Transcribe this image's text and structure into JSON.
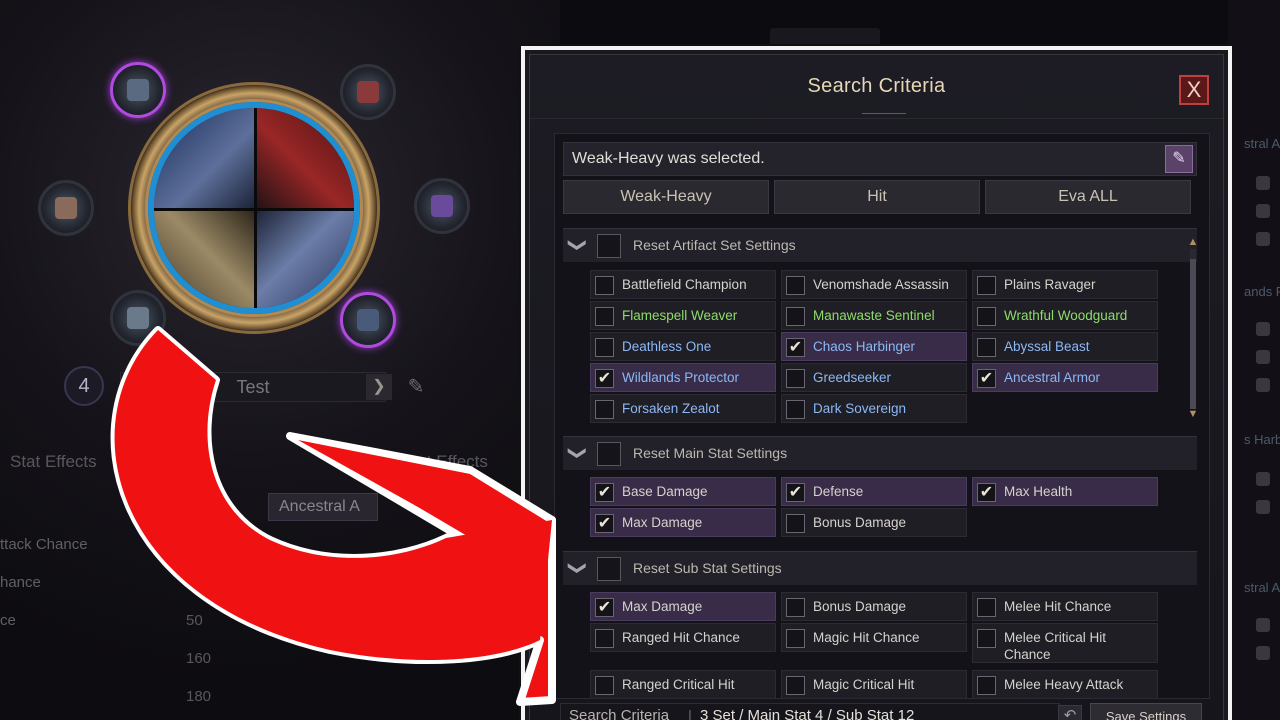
{
  "background": {
    "level": "4",
    "preset_name": "Test",
    "next_arrow": "❯",
    "edit_glyph": "✎",
    "tabs": [
      "Stat Effects",
      "Set Effects"
    ],
    "chip": "Ancestral A",
    "stats": [
      {
        "label": "ttack Chance",
        "value": ""
      },
      {
        "label": "hance",
        "value": ""
      },
      {
        "label": "ce",
        "value": "50"
      },
      {
        "label": "",
        "value": "160"
      },
      {
        "label": "",
        "value": "180"
      }
    ],
    "right_texts": [
      "stral A",
      "ands P",
      "s Harbi",
      "stral A"
    ]
  },
  "dialog": {
    "title": "Search Criteria",
    "close_label": "X",
    "selected_text": "Weak-Heavy was selected.",
    "edit_glyph": "✎",
    "presets": [
      "Weak-Heavy",
      "Hit",
      "Eva ALL"
    ],
    "sections": {
      "artifact": {
        "label": "Reset Artifact Set Settings",
        "options": [
          {
            "label": "Battlefield Champion",
            "checked": false,
            "color": "white"
          },
          {
            "label": "Venomshade Assassin",
            "checked": false,
            "color": "white"
          },
          {
            "label": "Plains Ravager",
            "checked": false,
            "color": "white"
          },
          {
            "label": "Flamespell Weaver",
            "checked": false,
            "color": "green"
          },
          {
            "label": "Manawaste Sentinel",
            "checked": false,
            "color": "green"
          },
          {
            "label": "Wrathful Woodguard",
            "checked": false,
            "color": "green"
          },
          {
            "label": "Deathless One",
            "checked": false,
            "color": "blue"
          },
          {
            "label": "Chaos Harbinger",
            "checked": true,
            "color": "blue"
          },
          {
            "label": "Abyssal Beast",
            "checked": false,
            "color": "blue"
          },
          {
            "label": "Wildlands Protector",
            "checked": true,
            "color": "blue"
          },
          {
            "label": "Greedseeker",
            "checked": false,
            "color": "blue"
          },
          {
            "label": "Ancestral Armor",
            "checked": true,
            "color": "blue"
          },
          {
            "label": "Forsaken Zealot",
            "checked": false,
            "color": "blue"
          },
          {
            "label": "Dark Sovereign",
            "checked": false,
            "color": "blue"
          }
        ]
      },
      "main": {
        "label": "Reset Main Stat Settings",
        "options": [
          {
            "label": "Base Damage",
            "checked": true
          },
          {
            "label": "Defense",
            "checked": true
          },
          {
            "label": "Max Health",
            "checked": true
          },
          {
            "label": "Max Damage",
            "checked": true
          },
          {
            "label": "Bonus Damage",
            "checked": false
          }
        ]
      },
      "sub": {
        "label": "Reset Sub Stat Settings",
        "options": [
          {
            "label": "Max Damage",
            "checked": true
          },
          {
            "label": "Bonus Damage",
            "checked": false
          },
          {
            "label": "Melee Hit Chance",
            "checked": false
          },
          {
            "label": "Ranged Hit Chance",
            "checked": false
          },
          {
            "label": "Magic Hit Chance",
            "checked": false
          },
          {
            "label": "Melee Critical Hit Chance",
            "checked": false
          },
          {
            "label": "Ranged Critical Hit",
            "checked": false
          },
          {
            "label": "Magic Critical Hit",
            "checked": false
          },
          {
            "label": "Melee Heavy Attack",
            "checked": false
          }
        ]
      }
    },
    "check_glyph": "✔",
    "chevron_glyph": "❯",
    "footer": {
      "label": "Search Criteria",
      "separator": "|",
      "summary": "3 Set / Main Stat 4 / Sub Stat 12",
      "reset_glyph": "↶",
      "save_label": "Save Settings"
    }
  },
  "colors": {
    "green": "#8edb6a",
    "blue": "#8cb8f5",
    "white": "#d6d2cc",
    "checked_bg": "#382c48",
    "arrow": "#f01212"
  }
}
